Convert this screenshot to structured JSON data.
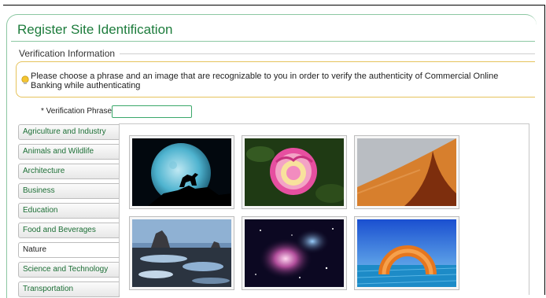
{
  "page": {
    "title": "Register Site Identification",
    "section_label": "Verification Information"
  },
  "info": {
    "message": "Please choose a phrase and an image that are recognizable to you in order to verify the authenticity of Commercial Online Banking while authenticating",
    "icon": "lightbulb-icon"
  },
  "verification": {
    "label": "* Verification Phrase",
    "value": "",
    "placeholder": ""
  },
  "categories": [
    {
      "label": "Agriculture and Industry",
      "active": false
    },
    {
      "label": "Animals and Wildlife",
      "active": false
    },
    {
      "label": "Architecture",
      "active": false
    },
    {
      "label": "Business",
      "active": false
    },
    {
      "label": "Education",
      "active": false
    },
    {
      "label": "Food and Beverages",
      "active": false
    },
    {
      "label": "Nature",
      "active": true
    },
    {
      "label": "Science and Technology",
      "active": false
    },
    {
      "label": "Transportation",
      "active": false
    }
  ],
  "images": [
    {
      "subject": "moon-silhouette-image"
    },
    {
      "subject": "rose-image"
    },
    {
      "subject": "sand-dune-image"
    },
    {
      "subject": "coastal-rocks-image"
    },
    {
      "subject": "nebula-image"
    },
    {
      "subject": "abstract-ring-image"
    }
  ],
  "colors": {
    "title": "#1d7c3c",
    "category_text": "#1d6f36",
    "input_border": "#3aa86a",
    "info_border": "#e6c35c"
  }
}
